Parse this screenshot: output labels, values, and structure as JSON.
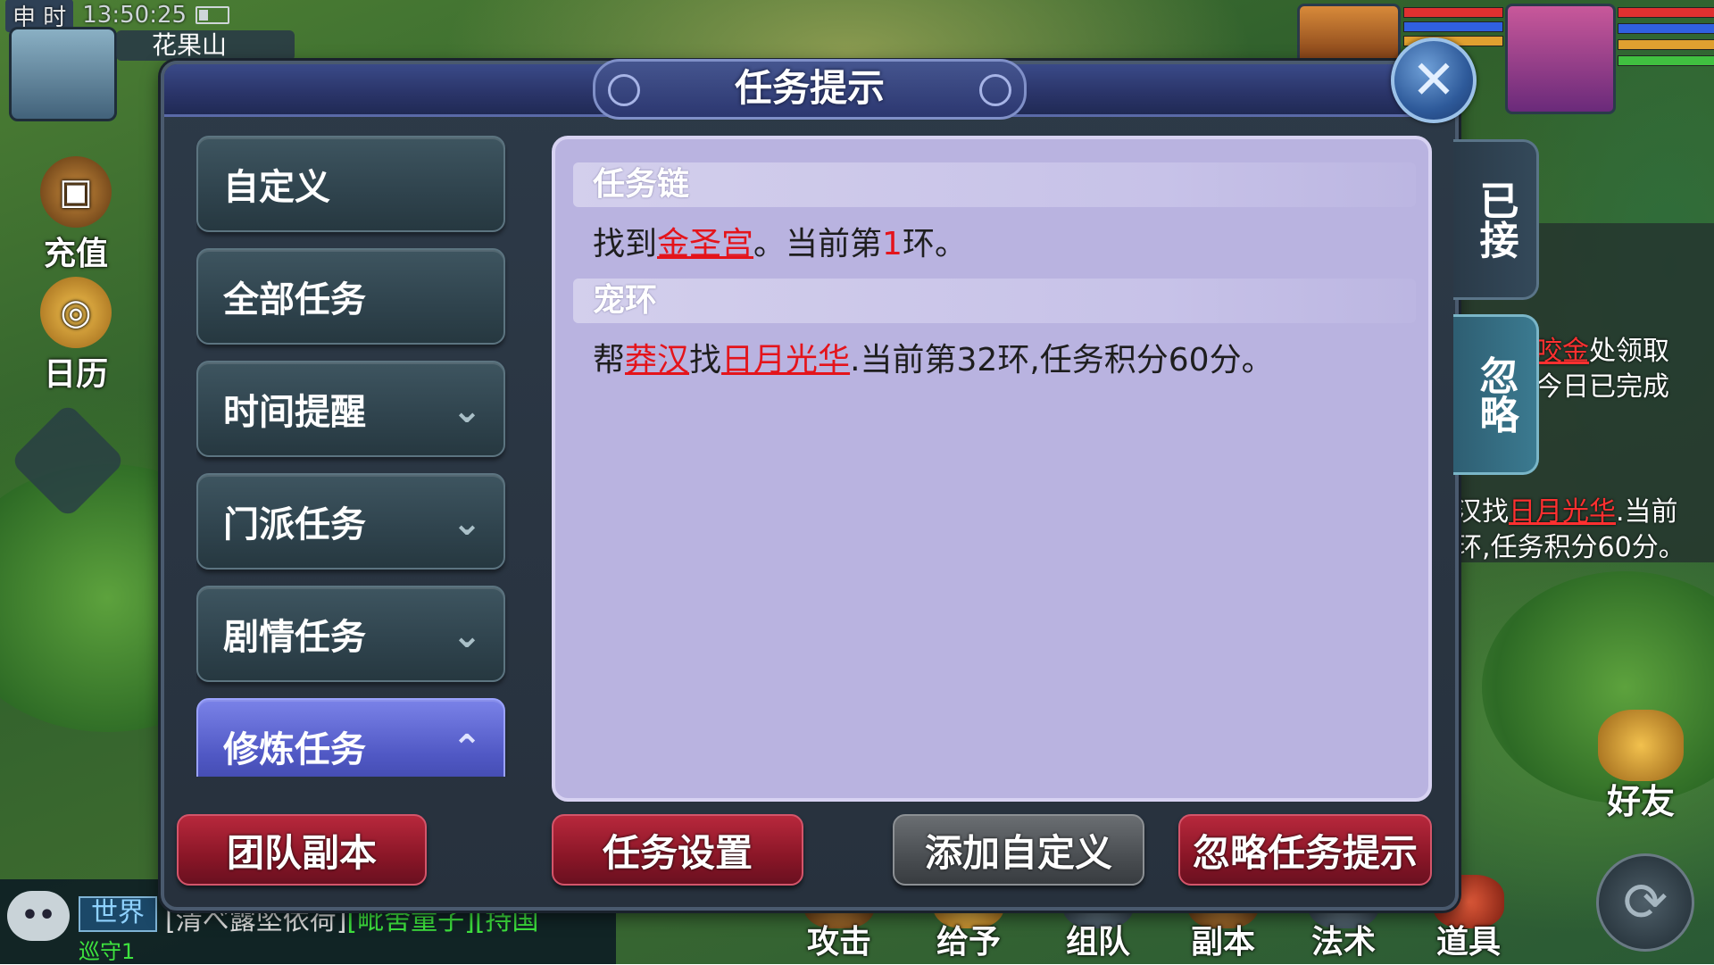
{
  "hud": {
    "shichen": "申 时",
    "clock": "13:50:25",
    "location": "花果山",
    "recharge_label": "充值",
    "calendar_label": "日历"
  },
  "dialog": {
    "title": "任务提示",
    "tabs": [
      {
        "label": "自定义",
        "has_chevron": false
      },
      {
        "label": "全部任务",
        "has_chevron": false
      },
      {
        "label": "时间提醒",
        "has_chevron": true
      },
      {
        "label": "门派任务",
        "has_chevron": true
      },
      {
        "label": "剧情任务",
        "has_chevron": true
      },
      {
        "label": "修炼任务",
        "has_chevron": true,
        "active": true
      }
    ],
    "sections": [
      {
        "head": "任务链",
        "body": {
          "pre": "找到",
          "link": "金圣宫",
          "mid": "。当前第",
          "num": "1",
          "post": "环。"
        }
      },
      {
        "head": "宠环",
        "body": {
          "pre": "帮",
          "link1": "莽汉",
          "mid": "找",
          "link2": "日月光华",
          "post": ".当前第32环,任务积分60分。"
        }
      }
    ],
    "buttons": {
      "team_dungeon": "团队副本",
      "task_settings": "任务设置",
      "add_custom": "添加自定义",
      "ignore_tips": "忽略任务提示"
    },
    "side_tabs": {
      "accepted": "已接",
      "ignored": "忽略"
    }
  },
  "behind_panel": {
    "line1_link": "咬金",
    "line1_rest": "处领取",
    "line2": "今日已完成",
    "line3_pre": "汉找",
    "line3_link": "日月光华",
    "line3_post": ".当前",
    "line4": "环,任务积分60分。"
  },
  "chat": {
    "icon_text": "••",
    "channel": "世界",
    "line1_name": "[清べ露坠依荷]",
    "line1_msg": "[毗舍童子][持国",
    "line2": "巡守1"
  },
  "bottom_actions": [
    "攻击",
    "给予",
    "组队",
    "副本",
    "法术",
    "道具"
  ],
  "friend_label": "好友",
  "colors": {
    "link_red": "#e4141b",
    "tab_active": "#5058c4",
    "content_bg": "#b9b3e0",
    "button_red": "#8a1627"
  }
}
